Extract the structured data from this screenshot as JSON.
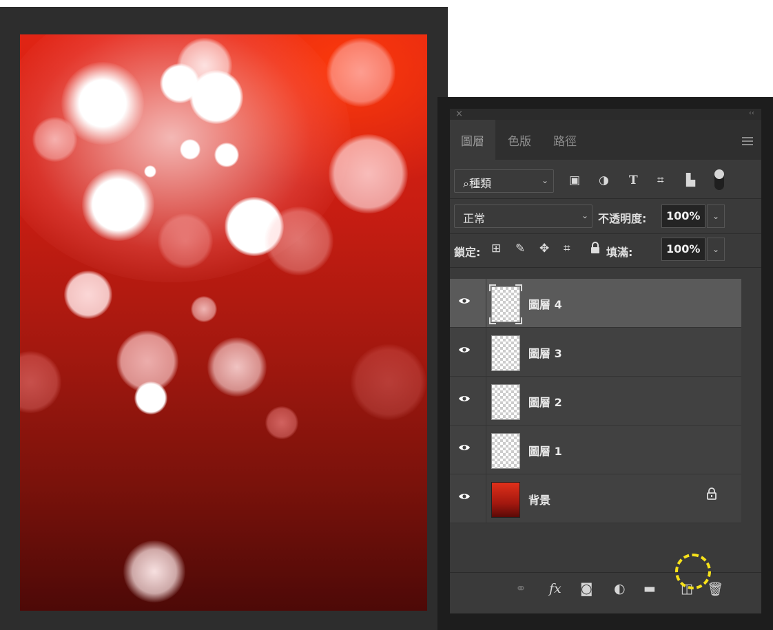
{
  "panel": {
    "close_glyph": "×",
    "collapse_glyph": "‹‹",
    "tabs": [
      {
        "label": "圖層"
      },
      {
        "label": "色版"
      },
      {
        "label": "路徑"
      }
    ],
    "filter": {
      "search_glyph": "⌕",
      "kind_label": "種類",
      "caret": "⌄",
      "icons": [
        "image-filter-icon",
        "adjustment-filter-icon",
        "type-filter-icon",
        "shape-filter-icon",
        "smart-object-filter-icon"
      ],
      "glyphs": [
        "▣",
        "◑",
        "T",
        "⌗",
        "▙"
      ]
    },
    "blend": {
      "mode": "正常",
      "caret": "⌄",
      "opacity_label": "不透明度:",
      "opacity_value": "100%"
    },
    "lock": {
      "label": "鎖定:",
      "icons": [
        "lock-transparent-pixels-icon",
        "lock-image-pixels-icon",
        "lock-position-icon",
        "lock-artboard-icon",
        "lock-all-icon"
      ],
      "glyphs": [
        "⊞",
        "✎",
        "✥",
        "⌗",
        "🔒"
      ],
      "fill_label": "填滿:",
      "fill_value": "100%",
      "caret": "⌄"
    },
    "layers": [
      {
        "name": "圖層 4",
        "selected": true,
        "type": "transparent"
      },
      {
        "name": "圖層 3",
        "selected": false,
        "type": "transparent"
      },
      {
        "name": "圖層 2",
        "selected": false,
        "type": "transparent"
      },
      {
        "name": "圖層 1",
        "selected": false,
        "type": "transparent"
      },
      {
        "name": "背景",
        "selected": false,
        "type": "background",
        "locked": true
      }
    ],
    "bottom_bar": {
      "icons": [
        "link-layers-icon",
        "fx-icon",
        "layer-mask-icon",
        "adjustment-layer-icon",
        "new-group-icon",
        "new-layer-icon",
        "trash-icon"
      ],
      "glyphs": [
        "⚭",
        "fx",
        "◙",
        "◐",
        "▬",
        "◫",
        "🗑"
      ],
      "highlight": "new-layer-icon",
      "highlight_color": "#f7e21a"
    }
  },
  "colors": {
    "canvas_red": "#c81d12",
    "panel_bg": "#3a3a3a",
    "selected_layer": "#5a5a5a"
  }
}
